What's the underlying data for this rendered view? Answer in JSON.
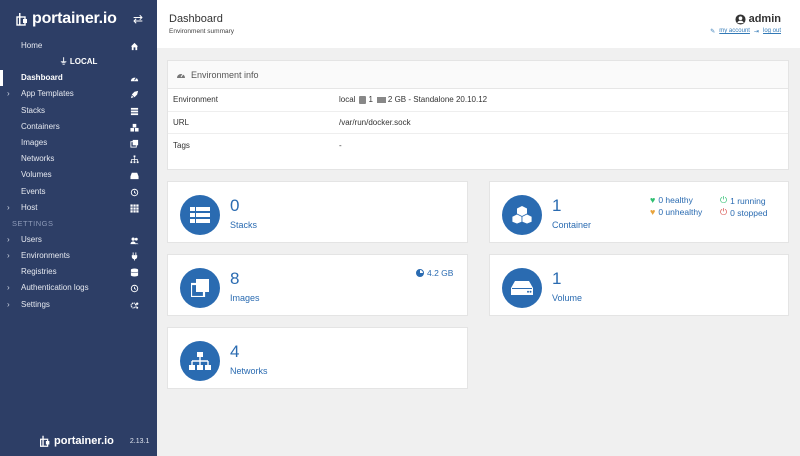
{
  "brand": {
    "name": "portainer.io",
    "version": "2.13.1"
  },
  "sidebar": {
    "home": "Home",
    "env_name": "LOCAL",
    "items": [
      {
        "label": "Dashboard"
      },
      {
        "label": "App Templates"
      },
      {
        "label": "Stacks"
      },
      {
        "label": "Containers"
      },
      {
        "label": "Images"
      },
      {
        "label": "Networks"
      },
      {
        "label": "Volumes"
      },
      {
        "label": "Events"
      },
      {
        "label": "Host"
      }
    ],
    "settings_heading": "SETTINGS",
    "settings_items": [
      {
        "label": "Users"
      },
      {
        "label": "Environments"
      },
      {
        "label": "Registries"
      },
      {
        "label": "Authentication logs"
      },
      {
        "label": "Settings"
      }
    ]
  },
  "header": {
    "title": "Dashboard",
    "subtitle": "Environment summary",
    "user": "admin",
    "my_account": "my account",
    "log_out": "log out"
  },
  "env_info": {
    "title": "Environment info",
    "rows": [
      {
        "key": "Environment",
        "name": "local",
        "cpu": "1",
        "mem": "2 GB - Standalone 20.10.12"
      },
      {
        "key": "URL",
        "value": "/var/run/docker.sock"
      },
      {
        "key": "Tags",
        "value": "-"
      }
    ]
  },
  "cards": {
    "stacks": {
      "count": "0",
      "label": "Stacks"
    },
    "containers": {
      "count": "1",
      "label": "Container",
      "healthy": "0 healthy",
      "running": "1 running",
      "unhealthy": "0 unhealthy",
      "stopped": "0 stopped"
    },
    "images": {
      "count": "8",
      "label": "Images",
      "size": "4.2 GB"
    },
    "volumes": {
      "count": "1",
      "label": "Volume"
    },
    "networks": {
      "count": "4",
      "label": "Networks"
    }
  },
  "colors": {
    "sidebar": "#2d3e66",
    "accent": "#2a6bb1",
    "healthy": "#2fbf71",
    "unhealthy": "#e8a33b",
    "stopped": "#d9534f"
  }
}
